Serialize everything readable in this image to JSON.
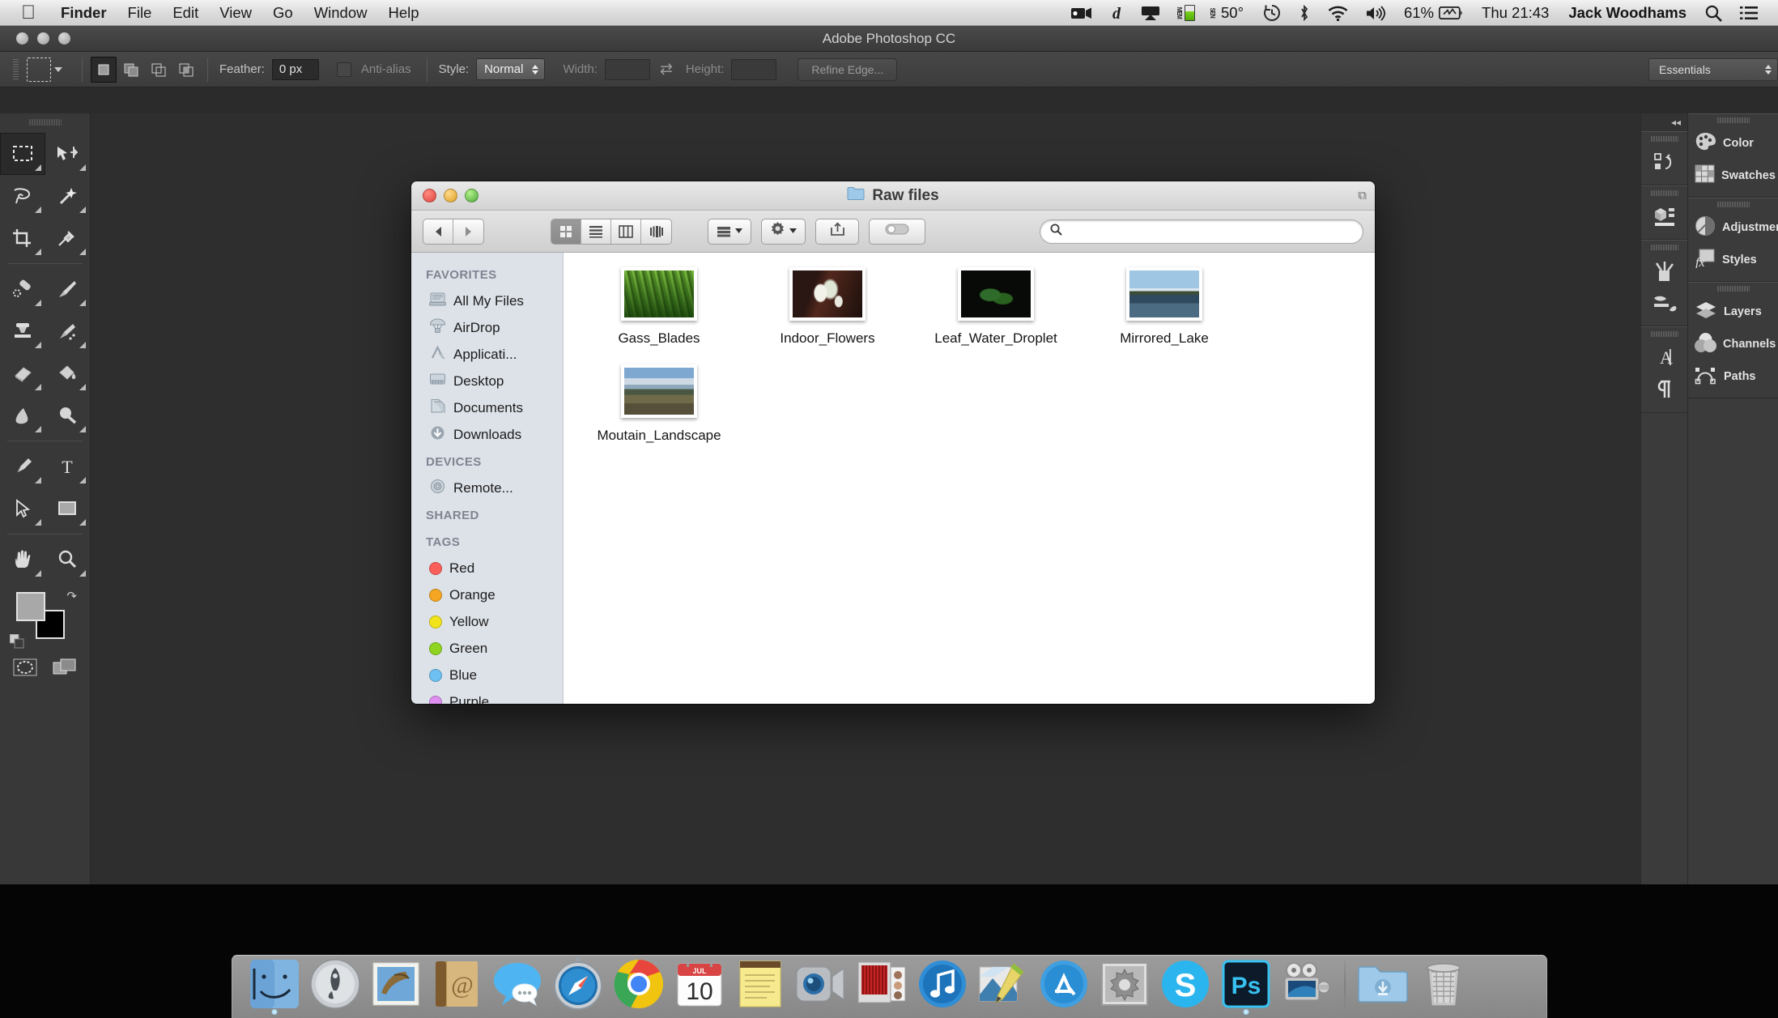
{
  "menubar": {
    "apple_icon": "apple-logo",
    "items": [
      {
        "label": "Finder",
        "bold": true
      },
      {
        "label": "File",
        "bold": false
      },
      {
        "label": "Edit",
        "bold": false
      },
      {
        "label": "View",
        "bold": false
      },
      {
        "label": "Go",
        "bold": false
      },
      {
        "label": "Window",
        "bold": false
      },
      {
        "label": "Help",
        "bold": false
      }
    ],
    "status": {
      "screen_recorder_icon": "video-camera-icon",
      "dictionary_icon": "dictionary-d-icon",
      "airplay_icon": "airplay-icon",
      "memory_label": "MEM",
      "sensor_label": "SEN",
      "temperature": "50°",
      "time_machine_icon": "time-machine-icon",
      "bluetooth_icon": "bluetooth-icon",
      "wifi_icon": "wifi-icon",
      "volume_icon": "volume-icon",
      "battery_percent": "61%",
      "battery_icon": "battery-icon",
      "clock": "Thu 21:43",
      "user": "Jack Woodhams",
      "spotlight_icon": "search-icon",
      "notification_icon": "notification-center-icon"
    }
  },
  "photoshop": {
    "title": "Adobe Photoshop CC",
    "workspace": "Essentials",
    "options": {
      "tool_icon": "rectangular-marquee-icon",
      "selection_modes": [
        "new-selection",
        "add-to-selection",
        "subtract-from-selection",
        "intersect-selection"
      ],
      "feather_label": "Feather:",
      "feather_value": "0 px",
      "antialias_label": "Anti-alias",
      "style_label": "Style:",
      "style_value": "Normal",
      "width_label": "Width:",
      "width_value": "",
      "swap_icon": "swap-dimensions-icon",
      "height_label": "Height:",
      "height_value": "",
      "refine_edge_label": "Refine Edge..."
    },
    "tools": [
      {
        "name": "rectangular-marquee-tool",
        "active": true
      },
      {
        "name": "move-tool",
        "active": false
      },
      {
        "name": "lasso-tool",
        "active": false
      },
      {
        "name": "magic-wand-tool",
        "active": false
      },
      {
        "name": "crop-tool",
        "active": false
      },
      {
        "name": "eyedropper-tool",
        "active": false
      },
      {
        "name": "spot-healing-brush-tool",
        "active": false
      },
      {
        "name": "brush-tool",
        "active": false
      },
      {
        "name": "clone-stamp-tool",
        "active": false
      },
      {
        "name": "history-brush-tool",
        "active": false
      },
      {
        "name": "eraser-tool",
        "active": false
      },
      {
        "name": "paint-bucket-tool",
        "active": false
      },
      {
        "name": "blur-tool",
        "active": false
      },
      {
        "name": "dodge-tool",
        "active": false
      },
      {
        "name": "pen-tool",
        "active": false
      },
      {
        "name": "type-tool",
        "active": false
      },
      {
        "name": "path-selection-tool",
        "active": false
      },
      {
        "name": "rectangle-tool",
        "active": false
      },
      {
        "name": "hand-tool",
        "active": false
      },
      {
        "name": "zoom-tool",
        "active": false
      }
    ],
    "colors": {
      "foreground": "#a8a8a8",
      "background": "#000000",
      "swap_icon": "swap-colors-icon",
      "default_icon": "default-colors-icon"
    },
    "bottom_tools": [
      {
        "name": "quick-mask-button"
      },
      {
        "name": "screen-mode-button"
      }
    ],
    "icon_strip": [
      {
        "name": "history-panel-icon"
      },
      {
        "name": "3d-panel-icon"
      },
      {
        "name": "brush-panel-icon"
      },
      {
        "name": "brush-presets-panel-icon"
      },
      {
        "name": "character-panel-icon"
      },
      {
        "name": "paragraph-panel-icon"
      }
    ],
    "panel_groups": [
      {
        "items": [
          {
            "label": "Color",
            "icon": "color-palette-icon"
          },
          {
            "label": "Swatches",
            "icon": "swatches-grid-icon"
          }
        ]
      },
      {
        "items": [
          {
            "label": "Adjustments",
            "icon": "adjustments-circle-icon"
          },
          {
            "label": "Styles",
            "icon": "styles-fx-icon"
          }
        ]
      },
      {
        "items": [
          {
            "label": "Layers",
            "icon": "layers-stack-icon"
          },
          {
            "label": "Channels",
            "icon": "channels-venn-icon"
          },
          {
            "label": "Paths",
            "icon": "paths-bezier-icon"
          }
        ]
      }
    ]
  },
  "finder": {
    "title": "Raw files",
    "folder_icon": "folder-icon",
    "window_buttons": [
      "close-button",
      "minimize-button",
      "zoom-button"
    ],
    "fullscreen_icon": "fullscreen-icon",
    "toolbar": {
      "back_icon": "back-arrow-icon",
      "forward_icon": "forward-arrow-icon",
      "view_modes": [
        {
          "name": "icon-view",
          "active": true
        },
        {
          "name": "list-view",
          "active": false
        },
        {
          "name": "column-view",
          "active": false
        },
        {
          "name": "coverflow-view",
          "active": false
        }
      ],
      "arrange_icon": "arrange-by-icon",
      "action_icon": "gear-icon",
      "share_icon": "share-icon",
      "tag_icon": "tag-icon",
      "search_icon": "search-icon",
      "search_value": "",
      "search_placeholder": ""
    },
    "sidebar": [
      {
        "header": "FAVORITES",
        "items": [
          {
            "label": "All My Files",
            "icon": "all-my-files-icon"
          },
          {
            "label": "AirDrop",
            "icon": "airdrop-icon"
          },
          {
            "label": "Applicati...",
            "icon": "applications-icon"
          },
          {
            "label": "Desktop",
            "icon": "desktop-icon"
          },
          {
            "label": "Documents",
            "icon": "documents-icon"
          },
          {
            "label": "Downloads",
            "icon": "downloads-icon"
          }
        ]
      },
      {
        "header": "DEVICES",
        "items": [
          {
            "label": "Remote...",
            "icon": "remote-disc-icon"
          }
        ]
      },
      {
        "header": "SHARED",
        "items": []
      },
      {
        "header": "TAGS",
        "items": [
          {
            "label": "Red",
            "icon": "tag-dot",
            "color": "#fa5f5a"
          },
          {
            "label": "Orange",
            "icon": "tag-dot",
            "color": "#f5a623"
          },
          {
            "label": "Yellow",
            "icon": "tag-dot",
            "color": "#f2e41c"
          },
          {
            "label": "Green",
            "icon": "tag-dot",
            "color": "#8fd420"
          },
          {
            "label": "Blue",
            "icon": "tag-dot",
            "color": "#6fc0f2"
          },
          {
            "label": "Purple",
            "icon": "tag-dot",
            "color": "#dd8ef0"
          }
        ]
      }
    ],
    "files": [
      {
        "name": "Gass_Blades",
        "thumb": "th-grass"
      },
      {
        "name": "Indoor_Flowers",
        "thumb": "th-flowers"
      },
      {
        "name": "Leaf_Water_Droplet",
        "thumb": "th-leaf"
      },
      {
        "name": "Mirrored_Lake",
        "thumb": "th-lake"
      },
      {
        "name": "Moutain_Landscape",
        "thumb": "th-mountain"
      }
    ]
  },
  "dock": {
    "items": [
      {
        "name": "finder",
        "icon": "finder-icon",
        "running": true
      },
      {
        "name": "launchpad",
        "icon": "launchpad-icon",
        "running": false
      },
      {
        "name": "mail",
        "icon": "mail-icon",
        "running": false
      },
      {
        "name": "contacts",
        "icon": "contacts-icon",
        "running": false
      },
      {
        "name": "messages",
        "icon": "messages-icon",
        "running": false
      },
      {
        "name": "safari",
        "icon": "safari-icon",
        "running": false
      },
      {
        "name": "chrome",
        "icon": "chrome-icon",
        "running": false
      },
      {
        "name": "calendar",
        "icon": "calendar-icon",
        "running": false,
        "month": "JUL",
        "day": "10"
      },
      {
        "name": "notes",
        "icon": "notes-icon",
        "running": false
      },
      {
        "name": "facetime",
        "icon": "facetime-icon",
        "running": false
      },
      {
        "name": "photo-booth",
        "icon": "photo-booth-icon",
        "running": false
      },
      {
        "name": "itunes",
        "icon": "itunes-icon",
        "running": false
      },
      {
        "name": "iphoto",
        "icon": "iphoto-icon",
        "running": false
      },
      {
        "name": "app-store",
        "icon": "app-store-icon",
        "running": false
      },
      {
        "name": "system-preferences",
        "icon": "system-preferences-icon",
        "running": false
      },
      {
        "name": "skype",
        "icon": "skype-icon",
        "running": false
      },
      {
        "name": "photoshop",
        "icon": "photoshop-icon",
        "running": true,
        "label": "Ps"
      },
      {
        "name": "imovie",
        "icon": "imovie-icon",
        "running": false
      },
      {
        "name": "downloads-folder",
        "icon": "downloads-folder-icon",
        "running": false
      },
      {
        "name": "trash",
        "icon": "trash-icon",
        "running": false
      }
    ]
  }
}
